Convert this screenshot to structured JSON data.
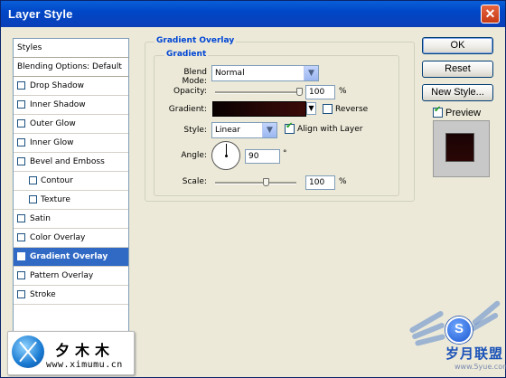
{
  "window": {
    "title": "Layer Style",
    "close_glyph": "✕"
  },
  "sidebar": {
    "header": "Styles",
    "blending": "Blending Options: Default",
    "items": [
      {
        "label": "Drop Shadow",
        "checked": false
      },
      {
        "label": "Inner Shadow",
        "checked": false
      },
      {
        "label": "Outer Glow",
        "checked": false
      },
      {
        "label": "Inner Glow",
        "checked": false
      },
      {
        "label": "Bevel and Emboss",
        "checked": false
      },
      {
        "label": "Contour",
        "checked": false,
        "sub": true
      },
      {
        "label": "Texture",
        "checked": false,
        "sub": true
      },
      {
        "label": "Satin",
        "checked": false
      },
      {
        "label": "Color Overlay",
        "checked": false
      },
      {
        "label": "Gradient Overlay",
        "checked": true,
        "selected": true
      },
      {
        "label": "Pattern Overlay",
        "checked": false
      },
      {
        "label": "Stroke",
        "checked": false
      }
    ]
  },
  "panel": {
    "title": "Gradient Overlay",
    "group": "Gradient",
    "blend_mode_label": "Blend Mode:",
    "blend_mode_value": "Normal",
    "opacity_label": "Opacity:",
    "opacity_value": "100",
    "opacity_level_pct": 100,
    "percent": "%",
    "gradient_label": "Gradient:",
    "reverse_label": "Reverse",
    "reverse_checked": false,
    "style_label": "Style:",
    "style_value": "Linear",
    "align_label": "Align with Layer",
    "align_checked": true,
    "angle_label": "Angle:",
    "angle_value": "90",
    "degree": "°",
    "scale_label": "Scale:",
    "scale_value": "100",
    "scale_level_pct": 100
  },
  "buttons": {
    "ok": "OK",
    "reset": "Reset",
    "new_style": "New Style...",
    "preview": "Preview",
    "preview_checked": true
  },
  "watermark": {
    "title": "夕木木",
    "url": "www.ximumu.cn"
  },
  "brand": {
    "letter": "S",
    "name": "岁月联盟",
    "sub": "www.5yue.com"
  },
  "colors": {
    "selection": "#316ac5",
    "group_title": "#0046d5",
    "gradient_dark": "#2a0706"
  }
}
